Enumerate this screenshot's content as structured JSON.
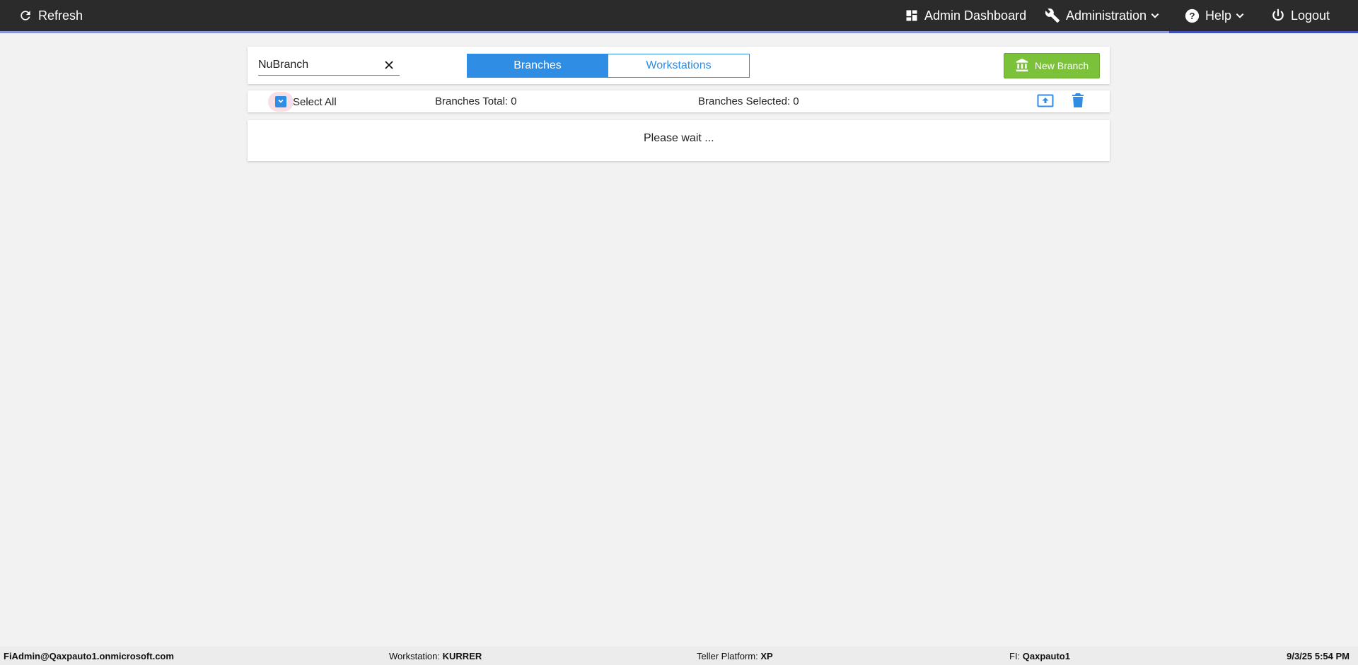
{
  "topbar": {
    "refresh_label": "Refresh",
    "admin_dashboard_label": "Admin Dashboard",
    "administration_label": "Administration",
    "help_label": "Help",
    "logout_label": "Logout"
  },
  "search": {
    "value": "NuBranch"
  },
  "tabs": {
    "branches": "Branches",
    "workstations": "Workstations"
  },
  "new_branch_label": "New Branch",
  "toolbar": {
    "select_all": "Select All",
    "branches_total": "Branches Total: 0",
    "branches_selected": "Branches Selected: 0"
  },
  "status_message": "Please wait ...",
  "footer": {
    "user": "FiAdmin@Qaxpauto1.onmicrosoft.com",
    "workstation_label": "Workstation:",
    "workstation_value": "KURRER",
    "platform_label": "Teller Platform:",
    "platform_value": "XP",
    "fi_label": "FI:",
    "fi_value": "Qaxpauto1",
    "datetime": "9/3/25 5:54 PM"
  },
  "colors": {
    "topbar": "#2b2b2b",
    "accent_blue": "#2f8de4",
    "new_branch_green": "#7cc13a",
    "active_underline": "#3f4fb8"
  },
  "icons": [
    "refresh-icon",
    "dashboard-icon",
    "wrench-icon",
    "chevron-down-icon",
    "help-icon",
    "power-icon",
    "close-icon",
    "bank-icon",
    "checkbox-chevron-icon",
    "upload-icon",
    "trash-icon"
  ]
}
